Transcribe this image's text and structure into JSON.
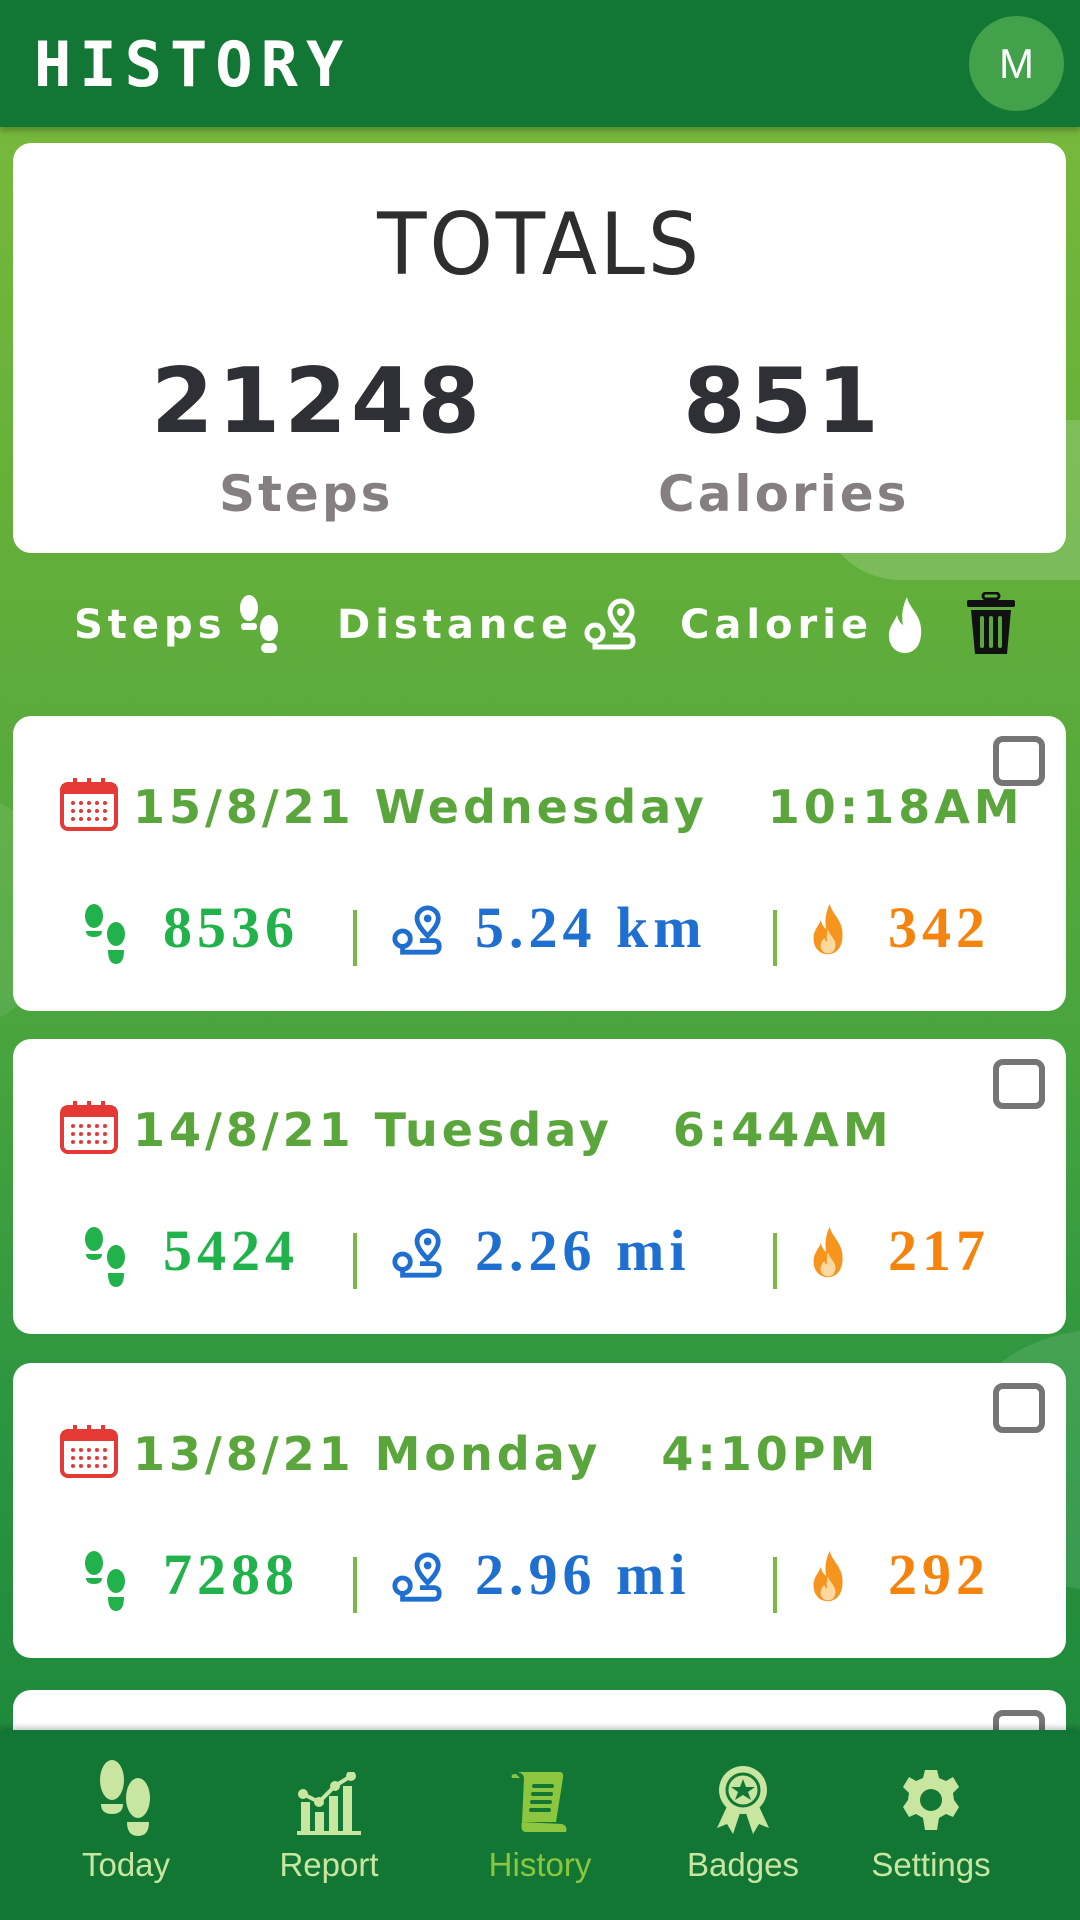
{
  "appbar": {
    "title": "HISTORY",
    "avatar_initial": "M"
  },
  "totals": {
    "title": "TOTALS",
    "steps_value": "21248",
    "steps_label": "Steps",
    "calories_value": "851",
    "calories_label": "Calories"
  },
  "sort_bar": {
    "steps_label": "Steps",
    "distance_label": "Distance",
    "calorie_label": "Calorie",
    "steps_icon": "footprints-icon",
    "distance_icon": "route-icon",
    "calorie_icon": "flame-icon",
    "delete_icon": "trash-icon"
  },
  "history": [
    {
      "date": "15/8/21 Wednesday",
      "time": "10:18AM",
      "steps": "8536",
      "distance": "5.24 km",
      "calories": "342",
      "checked": false
    },
    {
      "date": "14/8/21 Tuesday",
      "time": "6:44AM",
      "steps": "5424",
      "distance": "2.26 mi",
      "calories": "217",
      "checked": false
    },
    {
      "date": "13/8/21 Monday",
      "time": "4:10PM",
      "steps": "7288",
      "distance": "2.96 mi",
      "calories": "292",
      "checked": false
    }
  ],
  "bottom_nav": {
    "active": "History",
    "items": [
      {
        "label": "Today",
        "icon": "footprints-icon"
      },
      {
        "label": "Report",
        "icon": "chart-icon"
      },
      {
        "label": "History",
        "icon": "scroll-icon"
      },
      {
        "label": "Badges",
        "icon": "badge-icon"
      },
      {
        "label": "Settings",
        "icon": "gear-icon"
      }
    ]
  },
  "colors": {
    "appbar": "#127735",
    "date_text": "#5aa63d",
    "steps_text": "#22b24c",
    "distance_text": "#1f6fd1",
    "calories_text": "#f5840e",
    "calendar_icon": "#e53935",
    "nav_inactive": "#c8e6a0",
    "nav_active": "#8cc63f"
  }
}
